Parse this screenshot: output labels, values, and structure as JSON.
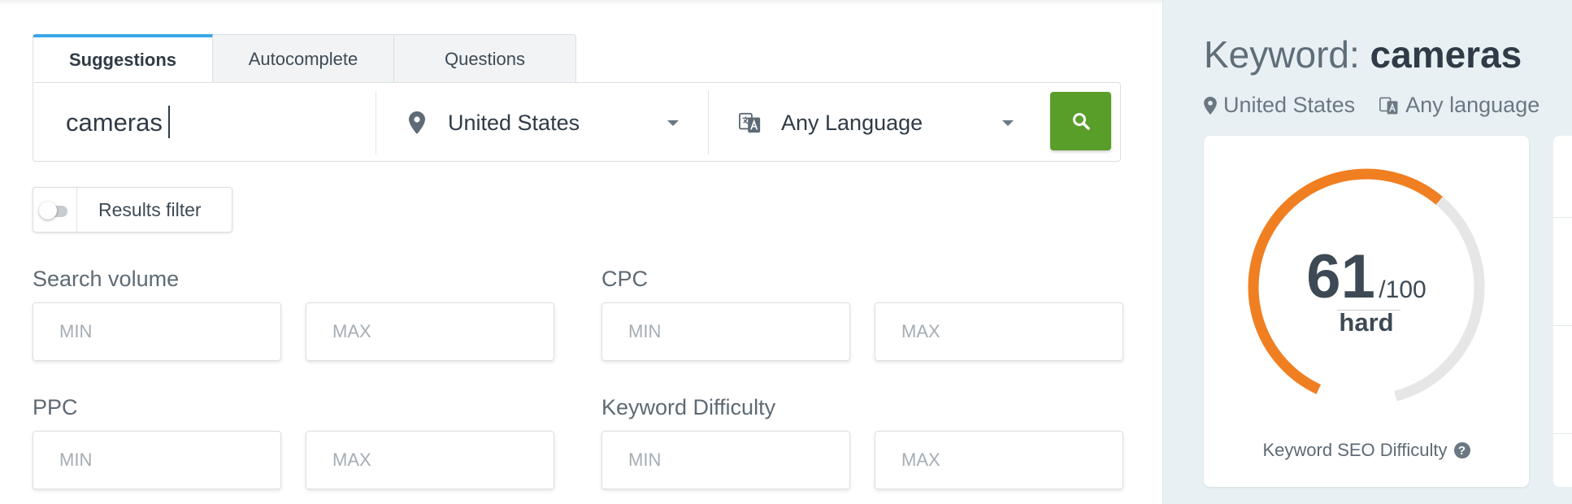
{
  "tabs": [
    {
      "label": "Suggestions",
      "active": true
    },
    {
      "label": "Autocomplete",
      "active": false
    },
    {
      "label": "Questions",
      "active": false
    }
  ],
  "search": {
    "value": "cameras",
    "location": "United States",
    "language": "Any Language",
    "button_icon": "search-icon",
    "button_color": "#5a9e2a"
  },
  "filter": {
    "label": "Results filter",
    "enabled": false
  },
  "filters": {
    "search_volume": {
      "label": "Search volume",
      "min_placeholder": "MIN",
      "max_placeholder": "MAX"
    },
    "cpc": {
      "label": "CPC",
      "min_placeholder": "MIN",
      "max_placeholder": "MAX"
    },
    "ppc": {
      "label": "PPC",
      "min_placeholder": "MIN",
      "max_placeholder": "MAX"
    },
    "keyword_difficulty": {
      "label": "Keyword Difficulty",
      "min_placeholder": "MIN",
      "max_placeholder": "MAX"
    }
  },
  "keyword_panel": {
    "title_prefix": "Keyword:",
    "keyword": "cameras",
    "location": "United States",
    "language": "Any language",
    "difficulty": {
      "score": 61,
      "max": "/100",
      "level": "hard",
      "caption": "Keyword SEO Difficulty",
      "help_icon": "?",
      "gauge_color": "#f07f22",
      "track_color": "#e6e6e6"
    }
  },
  "colors": {
    "tab_accent": "#3aa6e8",
    "panel_background": "#e8f0f4"
  }
}
